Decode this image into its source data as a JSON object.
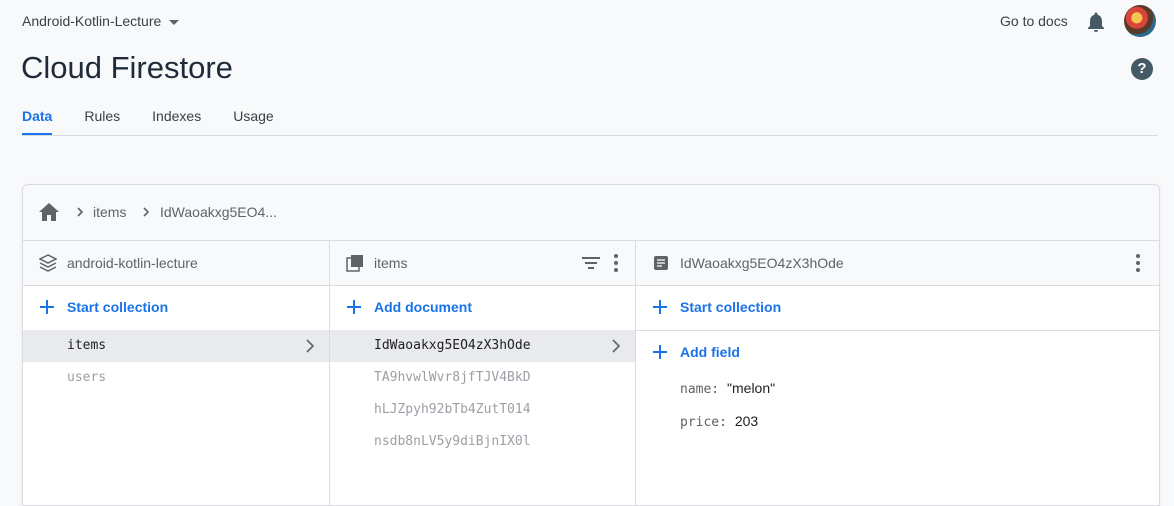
{
  "header": {
    "project": "Android-Kotlin-Lecture",
    "go_to_docs": "Go to docs",
    "title": "Cloud Firestore",
    "help": "?"
  },
  "tabs": [
    {
      "label": "Data",
      "active": true
    },
    {
      "label": "Rules",
      "active": false
    },
    {
      "label": "Indexes",
      "active": false
    },
    {
      "label": "Usage",
      "active": false
    }
  ],
  "breadcrumb": {
    "items": [
      "items",
      "IdWaoakxg5EO4..."
    ]
  },
  "columns": {
    "root": {
      "title": "android-kotlin-lecture",
      "add_label": "Start collection",
      "items": [
        {
          "label": "items",
          "selected": true
        },
        {
          "label": "users",
          "selected": false
        }
      ]
    },
    "collection": {
      "title": "items",
      "add_label": "Add document",
      "items": [
        {
          "label": "IdWaoakxg5EO4zX3hOde",
          "selected": true
        },
        {
          "label": "TA9hvwlWvr8jfTJV4BkD",
          "selected": false
        },
        {
          "label": "hLJZpyh92bTb4ZutT014",
          "selected": false
        },
        {
          "label": "nsdb8nLV5y9diBjnIX0l",
          "selected": false
        }
      ]
    },
    "document": {
      "title": "IdWaoakxg5EO4zX3hOde",
      "start_collection": "Start collection",
      "add_field": "Add field",
      "fields": [
        {
          "key": "name:",
          "value": "\"melon\""
        },
        {
          "key": "price:",
          "value": "203"
        }
      ]
    }
  },
  "colors": {
    "accent": "#1a73e8",
    "title": "#1f2b3a",
    "selected_row": "#e8eaed"
  }
}
